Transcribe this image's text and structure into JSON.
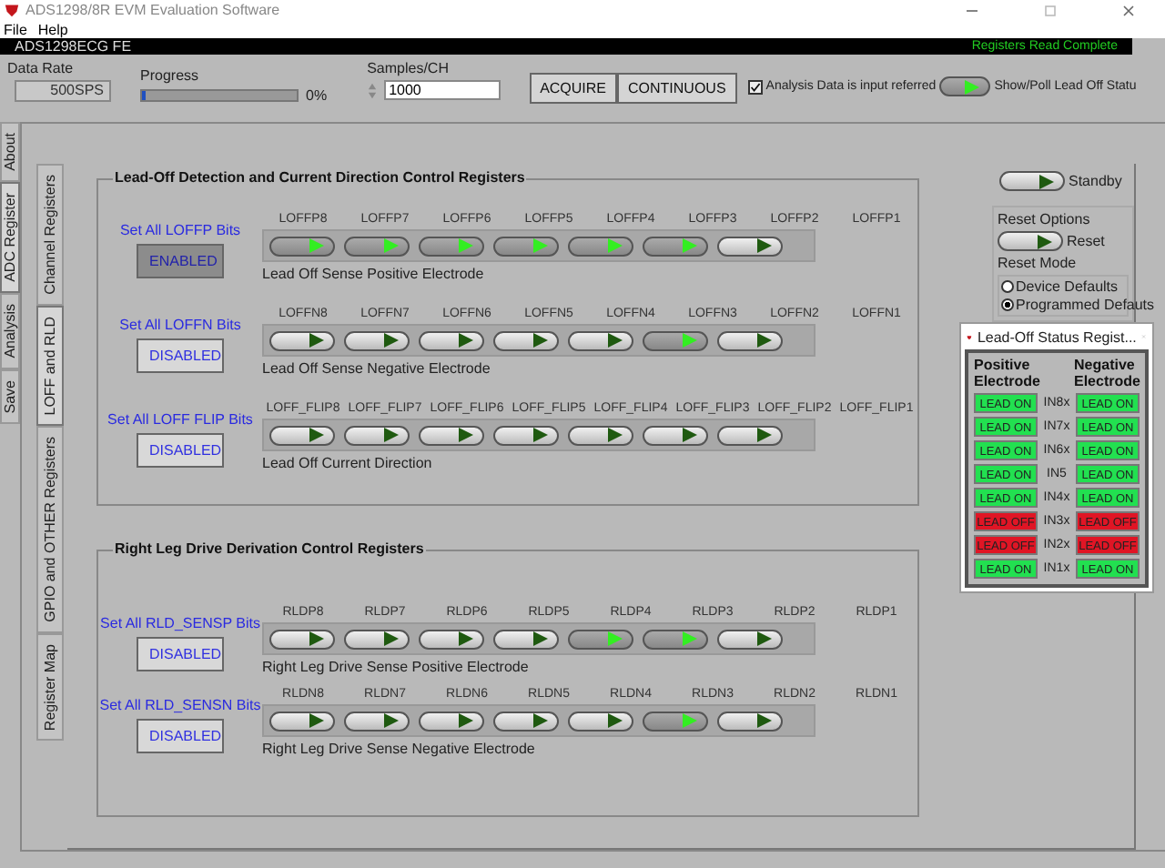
{
  "window": {
    "title": "ADS1298/8R EVM Evaluation Software"
  },
  "menu": [
    "File",
    "Help"
  ],
  "banner": {
    "title": "ADS1298ECG FE",
    "status": "Registers Read Complete"
  },
  "toolbar": {
    "data_rate": {
      "label": "Data Rate",
      "value": "500SPS"
    },
    "progress": {
      "label": "Progress",
      "level": 0.02,
      "reading": "0%"
    },
    "samples": {
      "label": "Samples/CH",
      "value": "1000"
    },
    "buttons": [
      "ACQUIRE",
      "CONTINUOUS"
    ],
    "analysis": {
      "label": "Analysis Data is input referred",
      "checked": true
    },
    "poll": {
      "label": "Show/Poll Lead Off Statu",
      "on": true
    }
  },
  "outer_tabs": [
    {
      "label": "About",
      "selected": false
    },
    {
      "label": "ADC Register",
      "selected": true
    },
    {
      "label": "Analysis",
      "selected": false
    },
    {
      "label": "Save",
      "selected": false
    }
  ],
  "inner_tabs": [
    {
      "label": "Channel Registers",
      "selected": false
    },
    {
      "label": "LOFF and RLD",
      "selected": true
    },
    {
      "label": "GPIO and OTHER Registers",
      "selected": false
    },
    {
      "label": "Register Map",
      "selected": false
    }
  ],
  "sections": [
    {
      "title": "Lead-Off Detection and Current Direction Control Registers",
      "rows": [
        {
          "set_label": "Set All LOFFP Bits",
          "button": "ENABLED",
          "enabled": true,
          "caption": "Lead Off Sense Positive Electrode",
          "bits": [
            {
              "label": "LOFFP8",
              "kind": "switch",
              "on": true
            },
            {
              "label": "LOFFP7",
              "kind": "switch",
              "on": true
            },
            {
              "label": "LOFFP6",
              "kind": "switch",
              "on": true
            },
            {
              "label": "LOFFP5",
              "kind": "switch",
              "on": true
            },
            {
              "label": "LOFFP4",
              "kind": "switch",
              "on": true
            },
            {
              "label": "LOFFP3",
              "kind": "switch",
              "on": true
            },
            {
              "label": "LOFFP2",
              "kind": "switch",
              "on": false
            },
            {
              "label": "LOFFP1",
              "kind": "label"
            }
          ]
        },
        {
          "set_label": "Set All LOFFN Bits",
          "button": "DISABLED",
          "enabled": false,
          "caption": "Lead Off Sense Negative Electrode",
          "bits": [
            {
              "label": "LOFFN8",
              "kind": "switch",
              "on": false
            },
            {
              "label": "LOFFN7",
              "kind": "switch",
              "on": false
            },
            {
              "label": "LOFFN6",
              "kind": "switch",
              "on": false
            },
            {
              "label": "LOFFN5",
              "kind": "switch",
              "on": false
            },
            {
              "label": "LOFFN4",
              "kind": "switch",
              "on": false
            },
            {
              "label": "LOFFN3",
              "kind": "switch",
              "on": true
            },
            {
              "label": "LOFFN2",
              "kind": "switch",
              "on": false
            },
            {
              "label": "LOFFN1",
              "kind": "label"
            }
          ]
        },
        {
          "set_label": "Set All LOFF FLIP Bits",
          "button": "DISABLED",
          "enabled": false,
          "caption": "Lead Off Current Direction",
          "bits": [
            {
              "label": "LOFF_FLIP8",
              "kind": "switch",
              "on": false
            },
            {
              "label": "LOFF_FLIP7",
              "kind": "switch",
              "on": false
            },
            {
              "label": "LOFF_FLIP6",
              "kind": "switch",
              "on": false
            },
            {
              "label": "LOFF_FLIP5",
              "kind": "switch",
              "on": false
            },
            {
              "label": "LOFF_FLIP4",
              "kind": "switch",
              "on": false
            },
            {
              "label": "LOFF_FLIP3",
              "kind": "switch",
              "on": false
            },
            {
              "label": "LOFF_FLIP2",
              "kind": "switch",
              "on": false
            },
            {
              "label": "LOFF_FLIP1",
              "kind": "label"
            }
          ]
        }
      ]
    },
    {
      "title": "Right Leg Drive Derivation Control Registers",
      "rows": [
        {
          "set_label": "Set All RLD_SENSP Bits",
          "button": "DISABLED",
          "enabled": false,
          "caption": "Right Leg Drive Sense Positive Electrode",
          "bits": [
            {
              "label": "RLDP8",
              "kind": "switch",
              "on": false
            },
            {
              "label": "RLDP7",
              "kind": "switch",
              "on": false
            },
            {
              "label": "RLDP6",
              "kind": "switch",
              "on": false
            },
            {
              "label": "RLDP5",
              "kind": "switch",
              "on": false
            },
            {
              "label": "RLDP4",
              "kind": "switch",
              "on": true
            },
            {
              "label": "RLDP3",
              "kind": "switch",
              "on": true
            },
            {
              "label": "RLDP2",
              "kind": "switch",
              "on": false
            },
            {
              "label": "RLDP1",
              "kind": "label"
            }
          ]
        },
        {
          "set_label": "Set All RLD_SENSN Bits",
          "button": "DISABLED",
          "enabled": false,
          "caption": "Right Leg Drive Sense Negative Electrode",
          "bits": [
            {
              "label": "RLDN8",
              "kind": "switch",
              "on": false
            },
            {
              "label": "RLDN7",
              "kind": "switch",
              "on": false
            },
            {
              "label": "RLDN6",
              "kind": "switch",
              "on": false
            },
            {
              "label": "RLDN5",
              "kind": "switch",
              "on": false
            },
            {
              "label": "RLDN4",
              "kind": "switch",
              "on": false
            },
            {
              "label": "RLDN3",
              "kind": "switch",
              "on": true
            },
            {
              "label": "RLDN2",
              "kind": "switch",
              "on": false
            },
            {
              "label": "RLDN1",
              "kind": "label"
            }
          ]
        }
      ]
    }
  ],
  "standby": {
    "label": "Standby",
    "on": false
  },
  "reset_options": {
    "title": "Reset Options",
    "reset": {
      "label": "Reset",
      "on": false
    },
    "mode_label": "Reset Mode",
    "modes": [
      {
        "label": "Device Defaults",
        "selected": false
      },
      {
        "label": "Programmed Defauts",
        "selected": true
      }
    ]
  },
  "status_window": {
    "title": "Lead-Off Status Regist...",
    "headers": [
      "Positive Electrode",
      "Negative Electrode"
    ],
    "rows": [
      {
        "channel": "IN8x",
        "positive": {
          "text": "LEAD ON",
          "ok": true
        },
        "negative": {
          "text": "LEAD ON",
          "ok": true
        }
      },
      {
        "channel": "IN7x",
        "positive": {
          "text": "LEAD ON",
          "ok": true
        },
        "negative": {
          "text": "LEAD ON",
          "ok": true
        }
      },
      {
        "channel": "IN6x",
        "positive": {
          "text": "LEAD ON",
          "ok": true
        },
        "negative": {
          "text": "LEAD ON",
          "ok": true
        }
      },
      {
        "channel": "IN5",
        "positive": {
          "text": "LEAD ON",
          "ok": true
        },
        "negative": {
          "text": "LEAD ON",
          "ok": true
        }
      },
      {
        "channel": "IN4x",
        "positive": {
          "text": "LEAD ON",
          "ok": true
        },
        "negative": {
          "text": "LEAD ON",
          "ok": true
        }
      },
      {
        "channel": "IN3x",
        "positive": {
          "text": "LEAD OFF",
          "ok": false
        },
        "negative": {
          "text": "LEAD OFF",
          "ok": false
        }
      },
      {
        "channel": "IN2x",
        "positive": {
          "text": "LEAD OFF",
          "ok": false
        },
        "negative": {
          "text": "LEAD OFF",
          "ok": false
        }
      },
      {
        "channel": "IN1x",
        "positive": {
          "text": "LEAD ON",
          "ok": true
        },
        "negative": {
          "text": "LEAD ON",
          "ok": true
        }
      }
    ]
  }
}
